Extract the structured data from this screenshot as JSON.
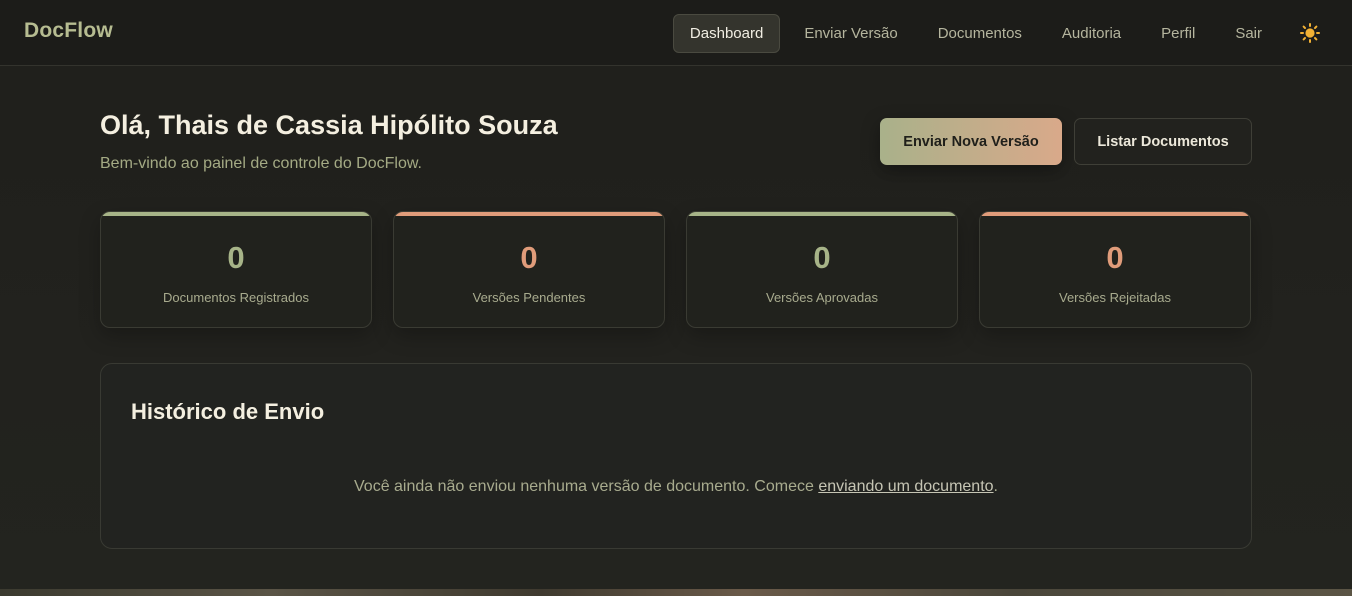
{
  "app": {
    "brand": "DocFlow"
  },
  "nav": {
    "items": [
      {
        "label": "Dashboard",
        "active": true
      },
      {
        "label": "Enviar Versão"
      },
      {
        "label": "Documentos"
      },
      {
        "label": "Auditoria"
      },
      {
        "label": "Perfil"
      },
      {
        "label": "Sair"
      }
    ],
    "theme_toggle_icon": "sun-icon"
  },
  "header": {
    "greeting": "Olá, Thais de Cassia Hipólito Souza",
    "subtitle": "Bem-vindo ao painel de controle do DocFlow.",
    "primary_button": "Enviar Nova Versão",
    "secondary_button": "Listar Documentos"
  },
  "stats": [
    {
      "value": "0",
      "label": "Documentos Registrados",
      "color": "#a7b488"
    },
    {
      "value": "0",
      "label": "Versões Pendentes",
      "color": "#e09c7a"
    },
    {
      "value": "0",
      "label": "Versões Aprovadas",
      "color": "#a7b488"
    },
    {
      "value": "0",
      "label": "Versões Rejeitadas",
      "color": "#e09c7a"
    }
  ],
  "history": {
    "title": "Histórico de Envio",
    "empty_text": "Você ainda não enviou nenhuma versão de documento. Comece ",
    "empty_link": "enviando um documento",
    "empty_suffix": "."
  },
  "colors": {
    "brand": "#b6bc91",
    "accent_green": "#a7b488",
    "accent_orange": "#e09c7a",
    "background": "#20201c"
  }
}
